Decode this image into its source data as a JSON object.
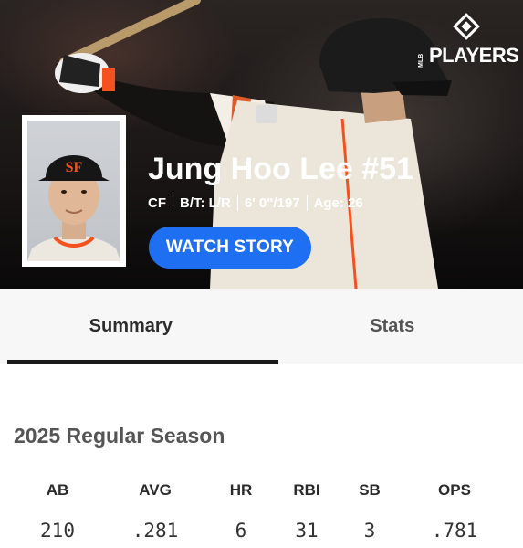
{
  "brand": {
    "logo_text": "PLAYERS",
    "logo_small": "MLB",
    "icon": "mlbpa-diamond-icon"
  },
  "player": {
    "name": "Jung Hoo Lee #51",
    "position": "CF",
    "bats_throws": "B/T: L/R",
    "height_weight": "6' 0\"/197",
    "age": "Age: 26"
  },
  "actions": {
    "watch_story": "WATCH STORY"
  },
  "tabs": [
    {
      "label": "Summary",
      "active": true
    },
    {
      "label": "Stats",
      "active": false
    }
  ],
  "season": {
    "title": "2025 Regular Season",
    "headers": [
      "AB",
      "AVG",
      "HR",
      "RBI",
      "SB",
      "OPS"
    ],
    "values": [
      "210",
      ".281",
      "6",
      "31",
      "3",
      ".781"
    ]
  },
  "colors": {
    "accent": "#1e6ff1",
    "hero_bg": "#1b1716",
    "tab_bg": "#f7f7f7",
    "giants_orange": "#f4511e"
  }
}
